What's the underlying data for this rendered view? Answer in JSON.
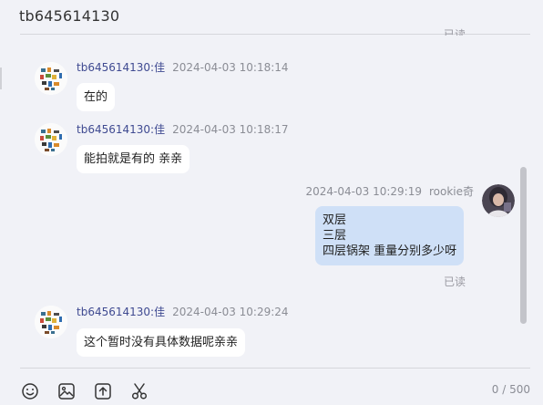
{
  "header": {
    "title": "tb645614130"
  },
  "stray_read": "已读",
  "messages": [
    {
      "sender": "tb645614130:佳",
      "time": "2024-04-03 10:18:14",
      "lines": [
        "在的"
      ]
    },
    {
      "sender": "tb645614130:佳",
      "time": "2024-04-03 10:18:17",
      "lines": [
        "能拍就是有的 亲亲"
      ]
    },
    {
      "sender": "rookie奇",
      "time": "2024-04-03 10:29:19",
      "lines": [
        "双层",
        "三层",
        "四层锅架 重量分别多少呀"
      ],
      "read": "已读"
    },
    {
      "sender": "tb645614130:佳",
      "time": "2024-04-03 10:29:24",
      "lines": [
        "这个暂时没有具体数据呢亲亲"
      ]
    }
  ],
  "toolbar": {
    "icons": [
      "emoji-icon",
      "image-icon",
      "upload-icon",
      "scissors-icon"
    ],
    "counter": "0 / 500"
  },
  "colors": {
    "background": "#f1f2f7",
    "sender_name": "#3f4a91",
    "my_bubble": "#cfe0f7",
    "other_bubble": "#ffffff"
  }
}
